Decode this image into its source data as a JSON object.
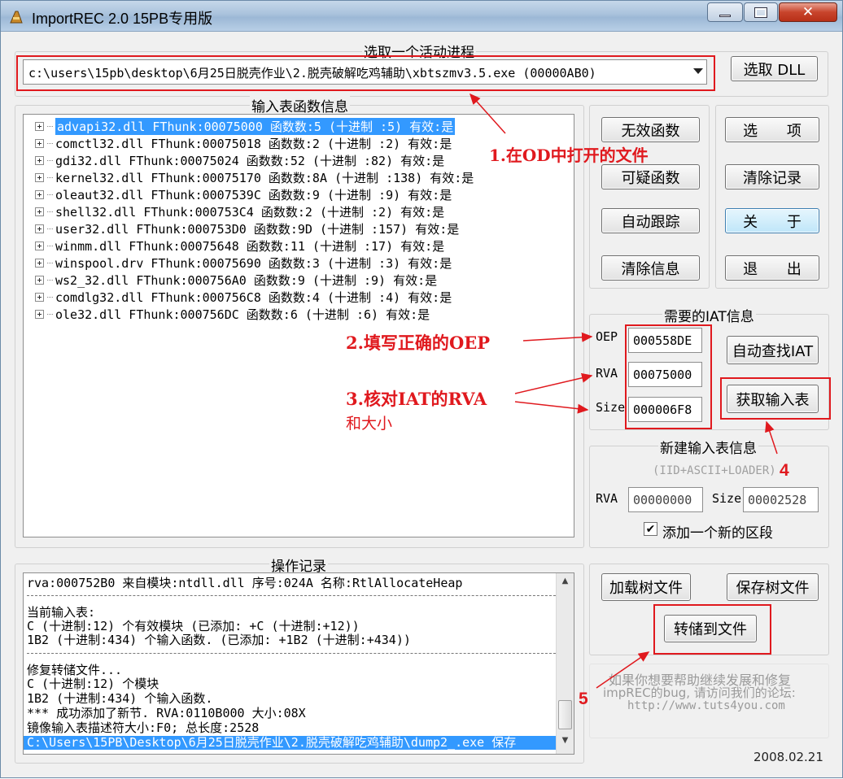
{
  "window": {
    "title": "ImportREC 2.0 15PB专用版",
    "minimize": "▁",
    "maximize": "□",
    "close": "✕"
  },
  "process": {
    "group_label": "选取一个活动进程",
    "selected": "c:\\users\\15pb\\desktop\\6月25日脱壳作业\\2.脱壳破解吃鸡辅助\\xbtszmv3.5.exe (00000AB0)",
    "pick_dll": "选取 DLL"
  },
  "imports": {
    "group_label": "输入表函数信息",
    "rows": [
      "advapi32.dll FThunk:00075000 函数数:5 (十进制 :5) 有效:是",
      "comctl32.dll FThunk:00075018 函数数:2 (十进制 :2) 有效:是",
      "gdi32.dll FThunk:00075024 函数数:52 (十进制 :82) 有效:是",
      "kernel32.dll FThunk:00075170 函数数:8A (十进制 :138) 有效:是",
      "oleaut32.dll FThunk:0007539C 函数数:9 (十进制 :9) 有效:是",
      "shell32.dll FThunk:000753C4 函数数:2 (十进制 :2) 有效:是",
      "user32.dll FThunk:000753D0 函数数:9D (十进制 :157) 有效:是",
      "winmm.dll FThunk:00075648 函数数:11 (十进制 :17) 有效:是",
      "winspool.drv FThunk:00075690 函数数:3 (十进制 :3) 有效:是",
      "ws2_32.dll FThunk:000756A0 函数数:9 (十进制 :9) 有效:是",
      "comdlg32.dll FThunk:000756C8 函数数:4 (十进制 :4) 有效:是",
      "ole32.dll FThunk:000756DC 函数数:6 (十进制 :6) 有效:是"
    ]
  },
  "buttons": {
    "invalid": "无效函数",
    "suspect": "可疑函数",
    "autotrace": "自动跟踪",
    "clearinfo": "清除信息",
    "options": "选 项",
    "clearlog": "清除记录",
    "about": "关 于",
    "exit": "退 出",
    "autoiat": "自动查找IAT",
    "getimports": "获取输入表",
    "loadtree": "加载树文件",
    "savetree": "保存树文件",
    "fixdump": "转储到文件"
  },
  "iat": {
    "group_label": "需要的IAT信息",
    "oep_label": "OEP",
    "oep": "000558DE",
    "rva_label": "RVA",
    "rva": "00075000",
    "size_label": "Size",
    "size": "000006F8"
  },
  "newimport": {
    "group_label": "新建输入表信息",
    "hint": "(IID+ASCII+LOADER)",
    "rva_label": "RVA",
    "rva": "00000000",
    "size_label": "Size",
    "size": "00002528",
    "add_section": "添加一个新的区段"
  },
  "log": {
    "group_label": "操作记录",
    "lines": [
      "rva:000752B0 来自模块:ntdll.dll 序号:024A 名称:RtlAllocateHeap",
      "当前输入表:",
      "C (十进制:12) 个有效模块 (已添加: +C (十进制:+12))",
      "1B2 (十进制:434) 个输入函数. (已添加: +1B2 (十进制:+434))",
      "修复转储文件...",
      "C (十进制:12) 个模块",
      "1B2 (十进制:434) 个输入函数.",
      "*** 成功添加了新节. RVA:0110B000 大小:08X",
      "镜像输入表描述符大小:F0; 总长度:2528",
      "C:\\Users\\15PB\\Desktop\\6月25日脱壳作业\\2.脱壳破解吃鸡辅助\\dump2_.exe 保存"
    ]
  },
  "help": {
    "line1": "如果你想要帮助继续发展和修复",
    "line2": "impREC的bug, 请访问我们的论坛:",
    "line3": "http://www.tuts4you.com"
  },
  "version": "2008.02.21",
  "annotations": {
    "a1": "1.在OD中打开的文件",
    "a2_num": "2.",
    "a2_text": "填写正确的",
    "a2_tail": "OEP",
    "a3_num": "3.",
    "a3_text": "核对",
    "a3_iat": "IAT",
    "a3_mid": "的",
    "a3_rva": "RVA",
    "a3_line2": "和大小",
    "a4": "4",
    "a5": "5"
  },
  "colors": {
    "annotation": "#e0191e",
    "selection": "#3399ff"
  }
}
